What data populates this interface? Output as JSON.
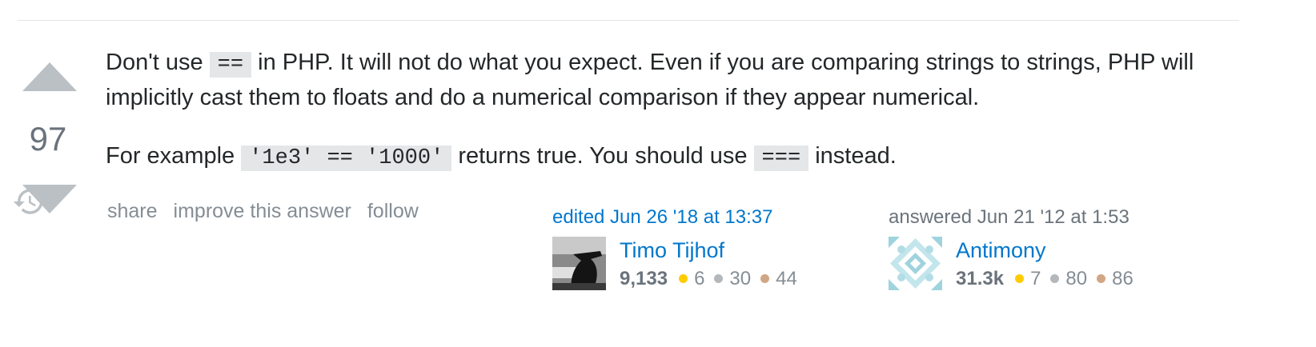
{
  "votes": {
    "count": "97"
  },
  "post": {
    "p1": {
      "t1": "Don't use",
      "c1": "==",
      "t2": "in PHP. It will not do what you expect. Even if you are comparing strings to strings, PHP will implicitly cast them to floats and do a numerical comparison if they appear numerical."
    },
    "p2": {
      "t1": "For example",
      "c1": "'1e3' == '1000'",
      "t2": "returns true. You should use",
      "c2": "===",
      "t3": "instead."
    }
  },
  "menu": {
    "share": "share",
    "improve": "improve this answer",
    "follow": "follow"
  },
  "editor": {
    "action": "edited Jun 26 '18 at 13:37",
    "name": "Timo Tijhof",
    "rep": "9,133",
    "gold": "6",
    "silver": "30",
    "bronze": "44"
  },
  "owner": {
    "action": "answered Jun 21 '12 at 1:53",
    "name": "Antimony",
    "rep": "31.3k",
    "gold": "7",
    "silver": "80",
    "bronze": "86"
  },
  "colors": {
    "link": "#0077cc",
    "vote_arrow": "#bbc0c4",
    "gold": "#ffcc01",
    "silver": "#b4b8bc",
    "bronze": "#d1a684"
  },
  "icons": {
    "up": "vote-up-arrow-icon",
    "down": "vote-down-arrow-icon",
    "history": "history-icon"
  }
}
